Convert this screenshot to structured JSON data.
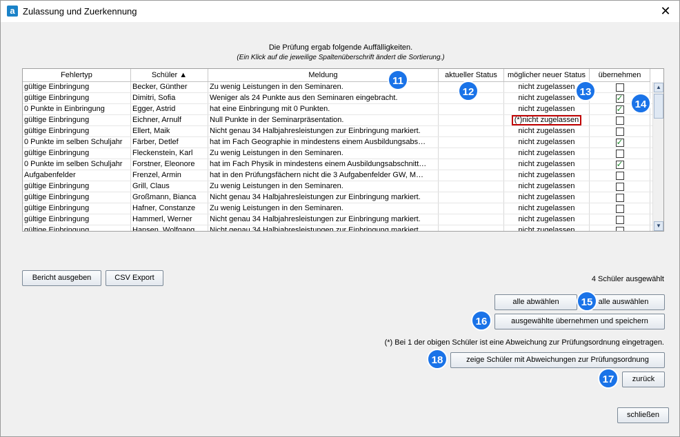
{
  "window": {
    "title": "Zulassung und Zuerkennung",
    "close_glyph": "✕",
    "app_icon_letter": "a"
  },
  "heading": {
    "line1": "Die Prüfung ergab folgende Auffälligkeiten.",
    "line2": "(Ein Klick auf die jeweilige Spaltenüberschrift ändert die Sortierung.)"
  },
  "table": {
    "columns": [
      "Fehlertyp",
      "Schüler ▲",
      "Meldung",
      "aktueller Status",
      "möglicher neuer Status",
      "übernehmen"
    ],
    "rows": [
      {
        "typ": "gültige Einbringung",
        "schueler": "Becker, Günther",
        "meldung": "Zu wenig Leistungen in den Seminaren.",
        "aktuell": "",
        "neu": "nicht zugelassen",
        "checked": false,
        "highlight": false
      },
      {
        "typ": "gültige Einbringung",
        "schueler": "Dimitri, Sofia",
        "meldung": "Weniger als 24 Punkte aus den Seminaren eingebracht.",
        "aktuell": "",
        "neu": "nicht zugelassen",
        "checked": true,
        "highlight": false
      },
      {
        "typ": "0 Punkte in Einbringung",
        "schueler": "Egger, Astrid",
        "meldung": "hat eine Einbringung mit 0 Punkten.",
        "aktuell": "",
        "neu": "nicht zugelassen",
        "checked": true,
        "highlight": false
      },
      {
        "typ": "gültige Einbringung",
        "schueler": "Eichner, Arnulf",
        "meldung": "Null Punkte in der Seminarpräsentation.",
        "aktuell": "",
        "neu": "(*)nicht zugelassen",
        "checked": false,
        "highlight": true
      },
      {
        "typ": "gültige Einbringung",
        "schueler": "Ellert, Maik",
        "meldung": "Nicht genau 34 Halbjahresleistungen zur Einbringung markiert.",
        "aktuell": "",
        "neu": "nicht zugelassen",
        "checked": false,
        "highlight": false
      },
      {
        "typ": "0 Punkte im selben Schuljahr",
        "schueler": "Färber, Detlef",
        "meldung": "hat im Fach Geographie in mindestens einem Ausbildungsabs…",
        "aktuell": "",
        "neu": "nicht zugelassen",
        "checked": true,
        "highlight": false
      },
      {
        "typ": "gültige Einbringung",
        "schueler": "Fleckenstein, Karl",
        "meldung": "Zu wenig Leistungen in den Seminaren.",
        "aktuell": "",
        "neu": "nicht zugelassen",
        "checked": false,
        "highlight": false
      },
      {
        "typ": "0 Punkte im selben Schuljahr",
        "schueler": "Forstner, Eleonore",
        "meldung": "hat im Fach Physik in mindestens einem Ausbildungsabschnitt…",
        "aktuell": "",
        "neu": "nicht zugelassen",
        "checked": true,
        "highlight": false
      },
      {
        "typ": "Aufgabenfelder",
        "schueler": "Frenzel, Armin",
        "meldung": "hat in den Prüfungsfächern nicht die 3 Aufgabenfelder GW, M…",
        "aktuell": "",
        "neu": "nicht zugelassen",
        "checked": false,
        "highlight": false
      },
      {
        "typ": "gültige Einbringung",
        "schueler": "Grill, Claus",
        "meldung": "Zu wenig Leistungen in den Seminaren.",
        "aktuell": "",
        "neu": "nicht zugelassen",
        "checked": false,
        "highlight": false
      },
      {
        "typ": "gültige Einbringung",
        "schueler": "Großmann, Bianca",
        "meldung": "Nicht genau 34 Halbjahresleistungen zur Einbringung markiert.",
        "aktuell": "",
        "neu": "nicht zugelassen",
        "checked": false,
        "highlight": false
      },
      {
        "typ": "gültige Einbringung",
        "schueler": "Hafner, Constanze",
        "meldung": "Zu wenig Leistungen in den Seminaren.",
        "aktuell": "",
        "neu": "nicht zugelassen",
        "checked": false,
        "highlight": false
      },
      {
        "typ": "gültige Einbringung",
        "schueler": "Hammerl, Werner",
        "meldung": "Nicht genau 34 Halbjahresleistungen zur Einbringung markiert.",
        "aktuell": "",
        "neu": "nicht zugelassen",
        "checked": false,
        "highlight": false
      },
      {
        "typ": "gültige Einbringung",
        "schueler": "Hansen, Wolfgang",
        "meldung": "Nicht genau 34 Halbjahresleistungen zur Einbringung markiert.",
        "aktuell": "",
        "neu": "nicht zugelassen",
        "checked": false,
        "highlight": false
      }
    ]
  },
  "buttons": {
    "bericht": "Bericht ausgeben",
    "csv": "CSV Export",
    "alle_abwaehlen": "alle abwählen",
    "alle_auswaehlen": "alle auswählen",
    "uebernehmen": "ausgewählte übernehmen und speichern",
    "zeige": "zeige Schüler mit Abweichungen zur Prüfungsordnung",
    "zurueck": "zurück",
    "schliessen": "schließen"
  },
  "status": {
    "selected_count": "4 Schüler ausgewählt",
    "abweichung_note": "(*) Bei 1 der obigen Schüler ist eine Abweichung zur Prüfungsordnung eingetragen."
  },
  "badges": {
    "b11": "11",
    "b12": "12",
    "b13": "13",
    "b14": "14",
    "b15": "15",
    "b16": "16",
    "b17": "17",
    "b18": "18"
  },
  "scroll": {
    "up": "▲",
    "down": "▼"
  },
  "colors": {
    "badge": "#1a73e8",
    "highlight_border": "#c00000",
    "check": "#1e8a2c"
  }
}
